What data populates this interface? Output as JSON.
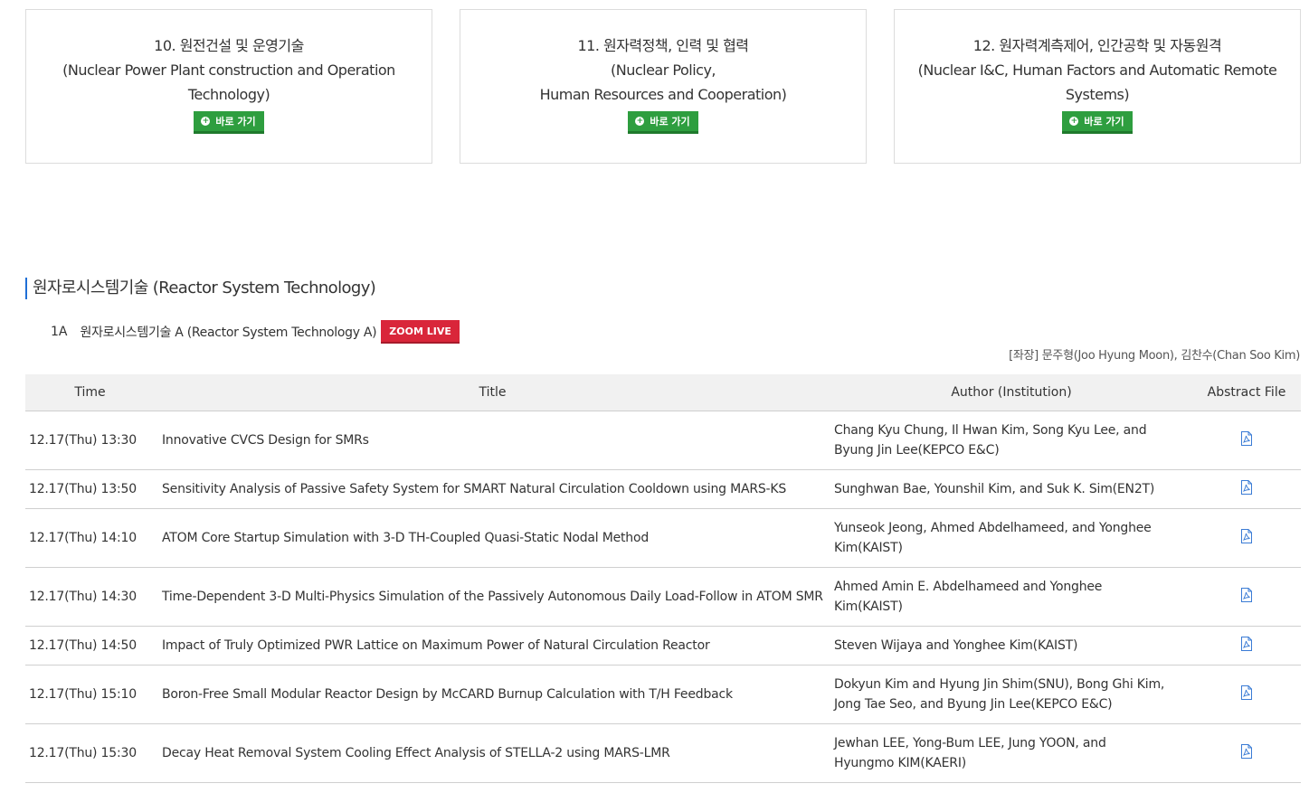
{
  "cards": [
    {
      "lines": [
        "10. 원전건설 및 운영기술",
        "(Nuclear Power Plant construction and Operation",
        "Technology)"
      ],
      "button": "바로 가기"
    },
    {
      "lines": [
        "11. 원자력정책, 인력 및 협력",
        "(Nuclear Policy,",
        "Human Resources and Cooperation)"
      ],
      "button": "바로 가기"
    },
    {
      "lines": [
        "12. 원자력계측제어, 인간공학 및 자동원격",
        "(Nuclear I&C, Human Factors and Automatic Remote",
        "Systems)"
      ],
      "button": "바로 가기"
    }
  ],
  "section": {
    "title": "원자로시스템기술 (Reactor System Technology)"
  },
  "session": {
    "code": "1A",
    "name": "원자로시스템기술 A (Reactor System Technology A)",
    "zoom_label": "ZOOM LIVE",
    "chair": "[좌장] 문주형(Joo Hyung Moon), 김찬수(Chan Soo Kim)"
  },
  "table": {
    "headers": [
      "Time",
      "Title",
      "Author (Institution)",
      "Abstract File"
    ],
    "rows": [
      {
        "time": "12.17(Thu) 13:30",
        "title": "Innovative CVCS Design for SMRs",
        "author": [
          "Chang Kyu Chung, Il Hwan Kim, Song Kyu Lee, and",
          "Byung Jin Lee(KEPCO E&C)"
        ]
      },
      {
        "time": "12.17(Thu) 13:50",
        "title": "Sensitivity Analysis of Passive Safety System for SMART Natural Circulation Cooldown using MARS-KS",
        "author": [
          "Sunghwan Bae, Younshil Kim, and Suk K. Sim(EN2T)"
        ]
      },
      {
        "time": "12.17(Thu) 14:10",
        "title": "ATOM Core Startup Simulation with 3-D TH-Coupled Quasi-Static Nodal Method",
        "author": [
          "Yunseok Jeong, Ahmed Abdelhameed, and Yonghee",
          "Kim(KAIST)"
        ]
      },
      {
        "time": "12.17(Thu) 14:30",
        "title": "Time-Dependent 3-D Multi-Physics Simulation of the Passively Autonomous Daily Load-Follow in ATOM SMR",
        "author": [
          "Ahmed Amin E. Abdelhameed and Yonghee",
          "Kim(KAIST)"
        ]
      },
      {
        "time": "12.17(Thu) 14:50",
        "title": "Impact of Truly Optimized PWR Lattice on Maximum Power of Natural Circulation Reactor",
        "author": [
          "Steven Wijaya and Yonghee Kim(KAIST)"
        ]
      },
      {
        "time": "12.17(Thu) 15:10",
        "title": "Boron-Free Small Modular Reactor Design by McCARD Burnup Calculation with T/H Feedback",
        "author": [
          "Dokyun Kim and Hyung Jin Shim(SNU), Bong Ghi Kim,",
          "Jong Tae Seo, and Byung Jin Lee(KEPCO E&C)"
        ]
      },
      {
        "time": "12.17(Thu) 15:30",
        "title": "Decay Heat Removal System Cooling Effect Analysis of STELLA-2 using MARS-LMR",
        "author": [
          "Jewhan LEE, Yong-Bum LEE, Jung YOON, and",
          "Hyungmo KIM(KAERI)"
        ]
      }
    ]
  },
  "colors": {
    "green_button": "#2e9e3f",
    "zoom_red": "#d9263a",
    "section_bar": "#1f6fd6",
    "pdf_icon": "#3a7bd5"
  },
  "icons": {
    "card_button": "plus-circle-icon",
    "abstract": "pdf-file-icon"
  }
}
